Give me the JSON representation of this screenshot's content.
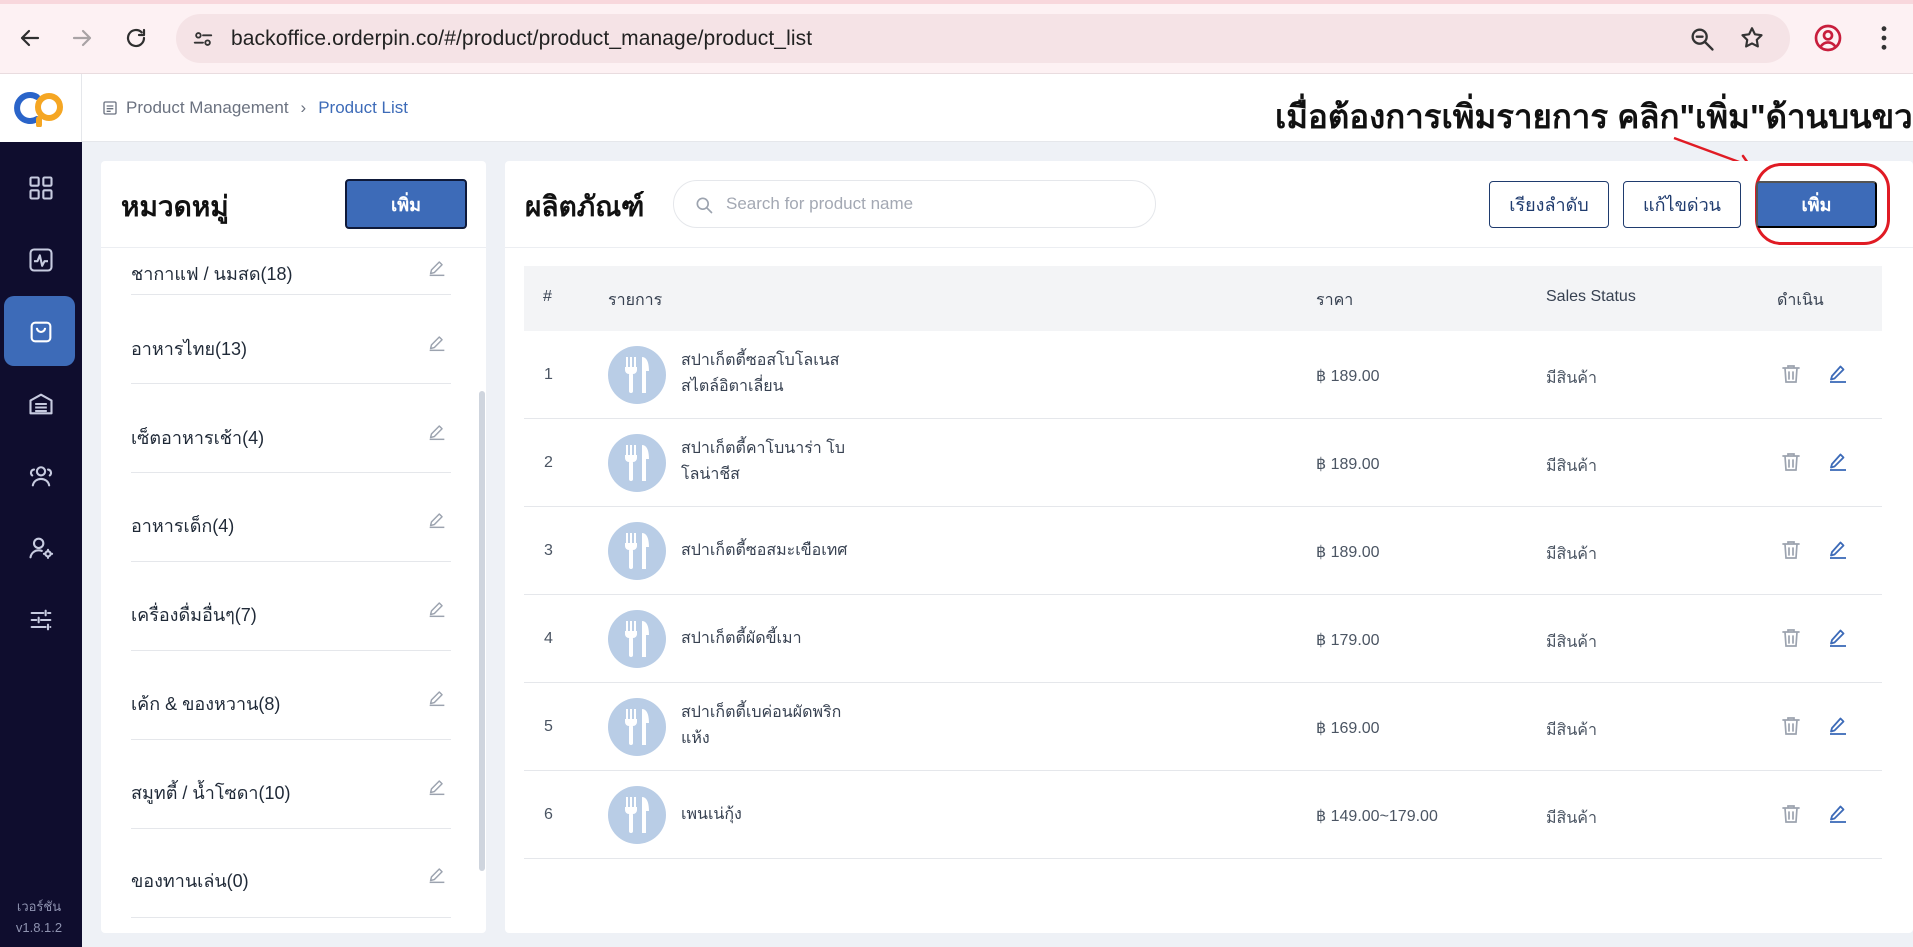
{
  "browser": {
    "url": "backoffice.orderpin.co/#/product/product_manage/product_list"
  },
  "sidebar": {
    "version_label": "เวอร์ชัน",
    "version": "v1.8.1.2",
    "icons": [
      "dashboard-icon",
      "activity-icon",
      "shopping-bag-icon",
      "warehouse-icon",
      "users-icon",
      "user-settings-icon",
      "sliders-icon"
    ]
  },
  "header": {
    "breadcrumb_root": "Product Management",
    "breadcrumb_current": "Product List"
  },
  "annotation": {
    "text": "เมื่อต้องการเพิ่มรายการ คลิก\"เพิ่ม\"ด้านบนขวา",
    "color": "#e01b24"
  },
  "categories": {
    "title": "หมวดหมู่",
    "add_label": "เพิ่ม",
    "items": [
      {
        "name": "ชากาแฟ / นมสด(18)"
      },
      {
        "name": "อาหารไทย(13)"
      },
      {
        "name": "เซ็ตอาหารเช้า(4)"
      },
      {
        "name": "อาหารเด็ก(4)"
      },
      {
        "name": "เครื่องดื่มอื่นๆ(7)"
      },
      {
        "name": "เค้ก & ของหวาน(8)"
      },
      {
        "name": "สมูทตี้ / น้ำโซดา(10)"
      },
      {
        "name": "ของทานเล่น(0)"
      }
    ]
  },
  "products": {
    "title": "ผลิตภัณฑ์",
    "search_placeholder": "Search for product name",
    "sort_label": "เรียงลำดับ",
    "quick_edit_label": "แก้ไขด่วน",
    "add_label": "เพิ่ม",
    "columns": {
      "num": "#",
      "item": "รายการ",
      "price": "ราคา",
      "status": "Sales Status",
      "action": "ดำเนิน"
    },
    "rows": [
      {
        "num": "1",
        "name_line1": "สปาเก็ตตี้ซอสโบโลเนส",
        "name_line2": "สไตล์อิตาเลี่ยน",
        "price": "฿ 189.00",
        "status": "มีสินค้า"
      },
      {
        "num": "2",
        "name_line1": "สปาเก็ตตี้คาโบนาร่า โบ",
        "name_line2": "โลน่าชีส",
        "price": "฿ 189.00",
        "status": "มีสินค้า"
      },
      {
        "num": "3",
        "name_line1": "สปาเก็ตตี้ซอสมะเขือเทศ",
        "name_line2": "",
        "price": "฿ 189.00",
        "status": "มีสินค้า"
      },
      {
        "num": "4",
        "name_line1": "สปาเก็ตตี้ผัดขี้เมา",
        "name_line2": "",
        "price": "฿ 179.00",
        "status": "มีสินค้า"
      },
      {
        "num": "5",
        "name_line1": "สปาเก็ตตี้เบค่อนผัดพริก",
        "name_line2": "แห้ง",
        "price": "฿ 169.00",
        "status": "มีสินค้า"
      },
      {
        "num": "6",
        "name_line1": "เพนเน่กุ้ง",
        "name_line2": "",
        "price": "฿ 149.00~179.00",
        "status": "มีสินค้า"
      }
    ]
  },
  "colors": {
    "primary": "#3d6bb8",
    "sidebar": "#0f0d2e",
    "highlight": "#e01b24"
  }
}
